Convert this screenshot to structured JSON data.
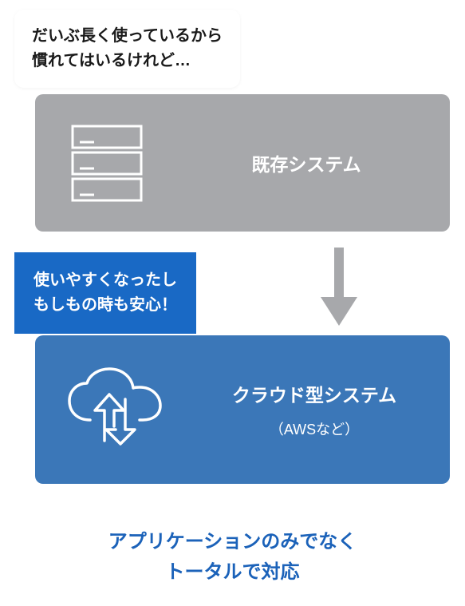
{
  "callout_top": "だいぶ長く使っているから\n慣れてはいるけれど…",
  "existing": {
    "label": "既存システム",
    "icon": "server-icon"
  },
  "callout_middle": "使いやすくなったし\nもしもの時も安心！",
  "cloud": {
    "label_main": "クラウド型システム",
    "label_sub": "（AWSなど）",
    "icon": "cloud-transfer-icon"
  },
  "footer": "アプリケーションのみでなく\nトータルで対応",
  "colors": {
    "gray_box": "#a7a8ab",
    "blue_box": "#3b77b8",
    "callout_blue": "#1969c5",
    "footer_text": "#1b62b9"
  }
}
